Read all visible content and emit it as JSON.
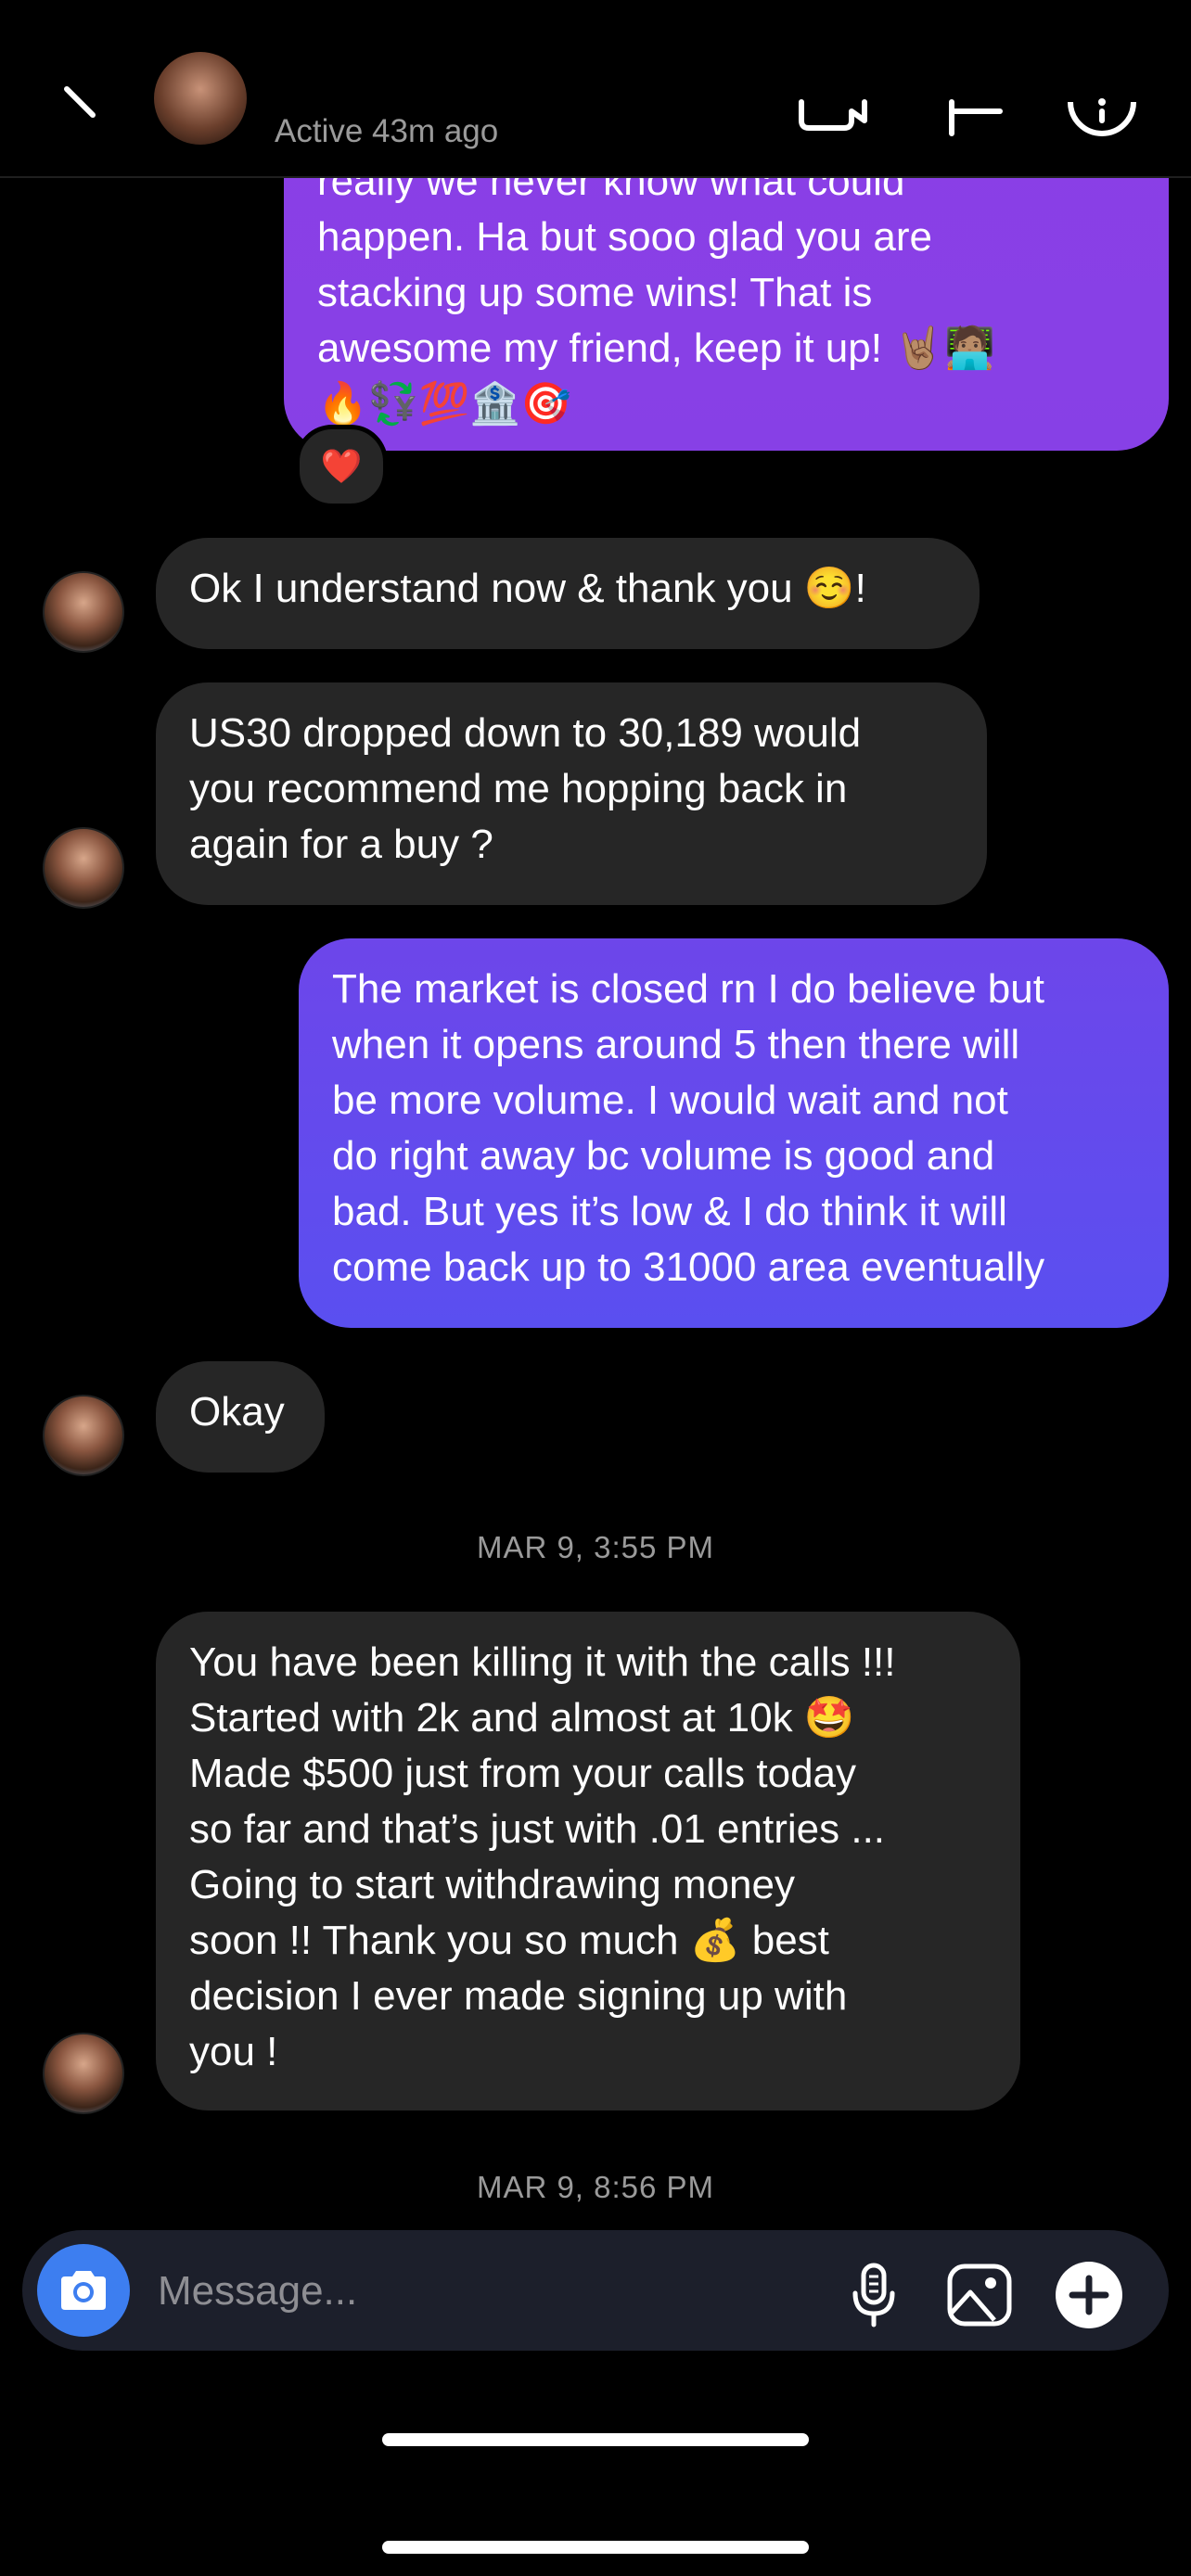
{
  "header": {
    "status": "Active 43m ago"
  },
  "messages": {
    "m1": "really we never know what could\nhappen. Ha but sooo glad you are\nstacking up some wins! That is\nawesome my friend, keep it up! 🤘🏽🧑🏽‍💻\n🔥💱💯🏦🎯",
    "m1_reaction": "❤️",
    "m2": "Ok I understand now & thank you ☺️!",
    "m3": "US30 dropped down to 30,189 would\nyou recommend me hopping back in\nagain for a buy ?",
    "m4": "The market is closed rn I do believe but\nwhen it opens around 5 then there will\nbe more volume. I would wait and not\ndo right away bc volume is good and\nbad. But yes it’s low & I do think it will\ncome back up to 31000 area eventually",
    "m5": "Okay",
    "ts1": "MAR 9, 3:55 PM",
    "m6": "You have been killing it with the calls !!!\nStarted with 2k and almost at 10k 🤩\nMade $500 just from your calls today\nso far and that’s just with .01 entries ...\nGoing to start withdrawing money\nsoon !! Thank you so much 💰 best\ndecision I ever made signing up with\nyou !",
    "ts2": "MAR 9, 8:56 PM"
  },
  "composer": {
    "placeholder": "Message..."
  },
  "colors": {
    "outgoing_top": "#8a3fe6",
    "outgoing_bottom": "#5b4ff0",
    "incoming": "#262626",
    "camera": "#3d7ef0"
  },
  "icons": [
    "back-icon",
    "video-call-icon",
    "flag-icon",
    "info-icon",
    "camera-icon",
    "microphone-icon",
    "gallery-icon",
    "plus-icon"
  ]
}
